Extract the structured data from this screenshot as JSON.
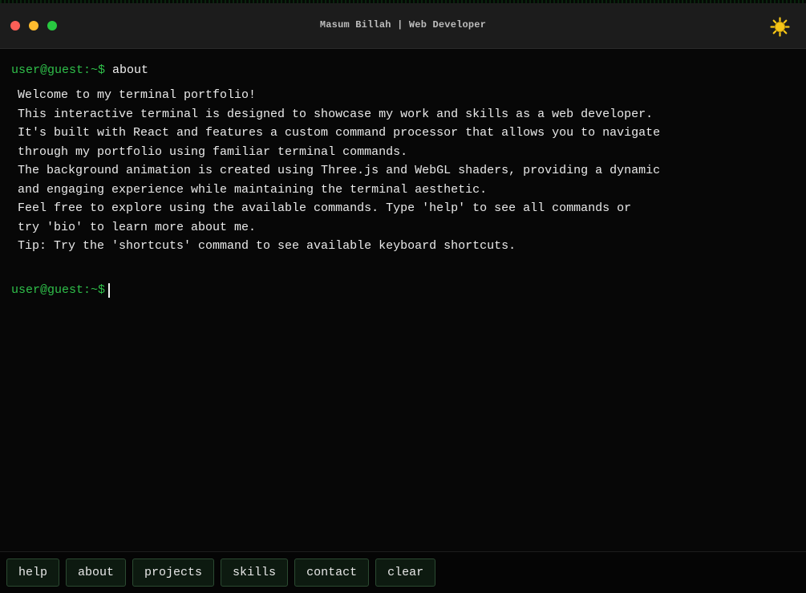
{
  "window": {
    "title": "Masum Billah | Web Developer",
    "theme_icon": "sun-icon"
  },
  "terminal": {
    "history": {
      "prompt": "user@guest:~$",
      "command": "about",
      "output": [
        "Welcome to my terminal portfolio!",
        "This interactive terminal is designed to showcase my work and skills as a web developer.",
        "It's built with React and features a custom command processor that allows you to navigate",
        "through my portfolio using familiar terminal commands.",
        "The background animation is created using Three.js and WebGL shaders, providing a dynamic",
        "and engaging experience while maintaining the terminal aesthetic.",
        "Feel free to explore using the available commands. Type 'help' to see all commands or",
        "try 'bio' to learn more about me.",
        "Tip: Try the 'shortcuts' command to see available keyboard shortcuts."
      ]
    },
    "current_prompt": "user@guest:~$"
  },
  "quick_commands": {
    "help": "help",
    "about": "about",
    "projects": "projects",
    "skills": "skills",
    "contact": "contact",
    "clear": "clear"
  },
  "colors": {
    "prompt": "#2fbf4a",
    "button_bg": "#0d1a10",
    "button_border": "#2b4a31",
    "sun": "#f5c518"
  }
}
